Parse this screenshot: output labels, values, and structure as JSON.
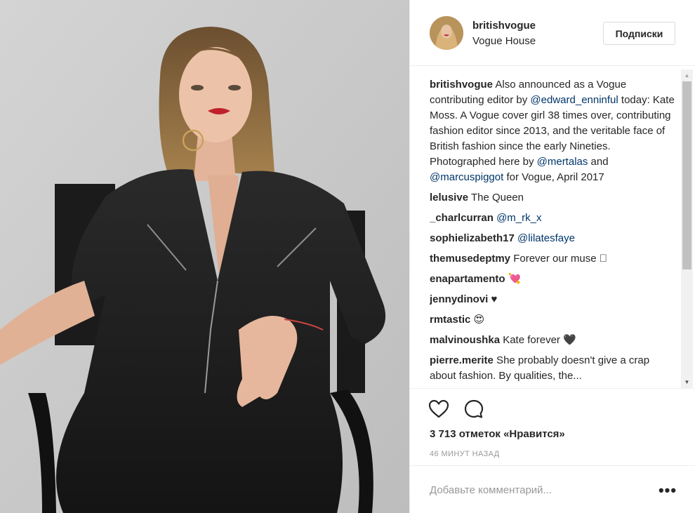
{
  "post": {
    "username": "britishvogue",
    "location": "Vogue House",
    "follow_label": "Подписки"
  },
  "caption": {
    "username": "britishvogue",
    "t1": " Also announced as a Vogue contributing editor by ",
    "m1": "@edward_enninful",
    "t2": " today: Kate Moss. A Vogue cover girl 38 times over, contributing fashion editor since 2013, and the veritable face of British fashion since the early Nineties. Photographed here by ",
    "m2": "@mertalas",
    "t3": " and ",
    "m3": "@marcuspiggot",
    "t4": " for Vogue, April 2017"
  },
  "comments": [
    {
      "user": "lelusive",
      "text": " The Queen",
      "mention": ""
    },
    {
      "user": "_charlcurran",
      "text": " ",
      "mention": "@m_rk_x"
    },
    {
      "user": "sophielizabeth17",
      "text": " ",
      "mention": "@lilatesfaye"
    },
    {
      "user": "themusedeptmy",
      "text": " Forever our muse 🏻",
      "mention": ""
    },
    {
      "user": "enapartamento",
      "text": " 💘",
      "mention": ""
    },
    {
      "user": "jennydinovi",
      "text": " ♥",
      "mention": ""
    },
    {
      "user": "rmtastic",
      "text": " 😍",
      "mention": ""
    },
    {
      "user": "malvinoushka",
      "text": " Kate forever 🖤",
      "mention": ""
    },
    {
      "user": "pierre.merite",
      "text": " She probably doesn't give a crap about fashion. By qualities, the...",
      "mention": ""
    }
  ],
  "stats": {
    "likes": "3 713 отметок «Нравится»",
    "time": "46 МИНУТ НАЗАД"
  },
  "composer": {
    "placeholder": "Добавьте комментарий...",
    "more": "•••"
  },
  "icons": {
    "like": "heart-outline-icon",
    "comment": "speech-bubble-icon",
    "more": "ellipsis-icon"
  },
  "colors": {
    "text": "#262626",
    "mention": "#003569",
    "muted": "#999999",
    "border": "#efefef"
  }
}
